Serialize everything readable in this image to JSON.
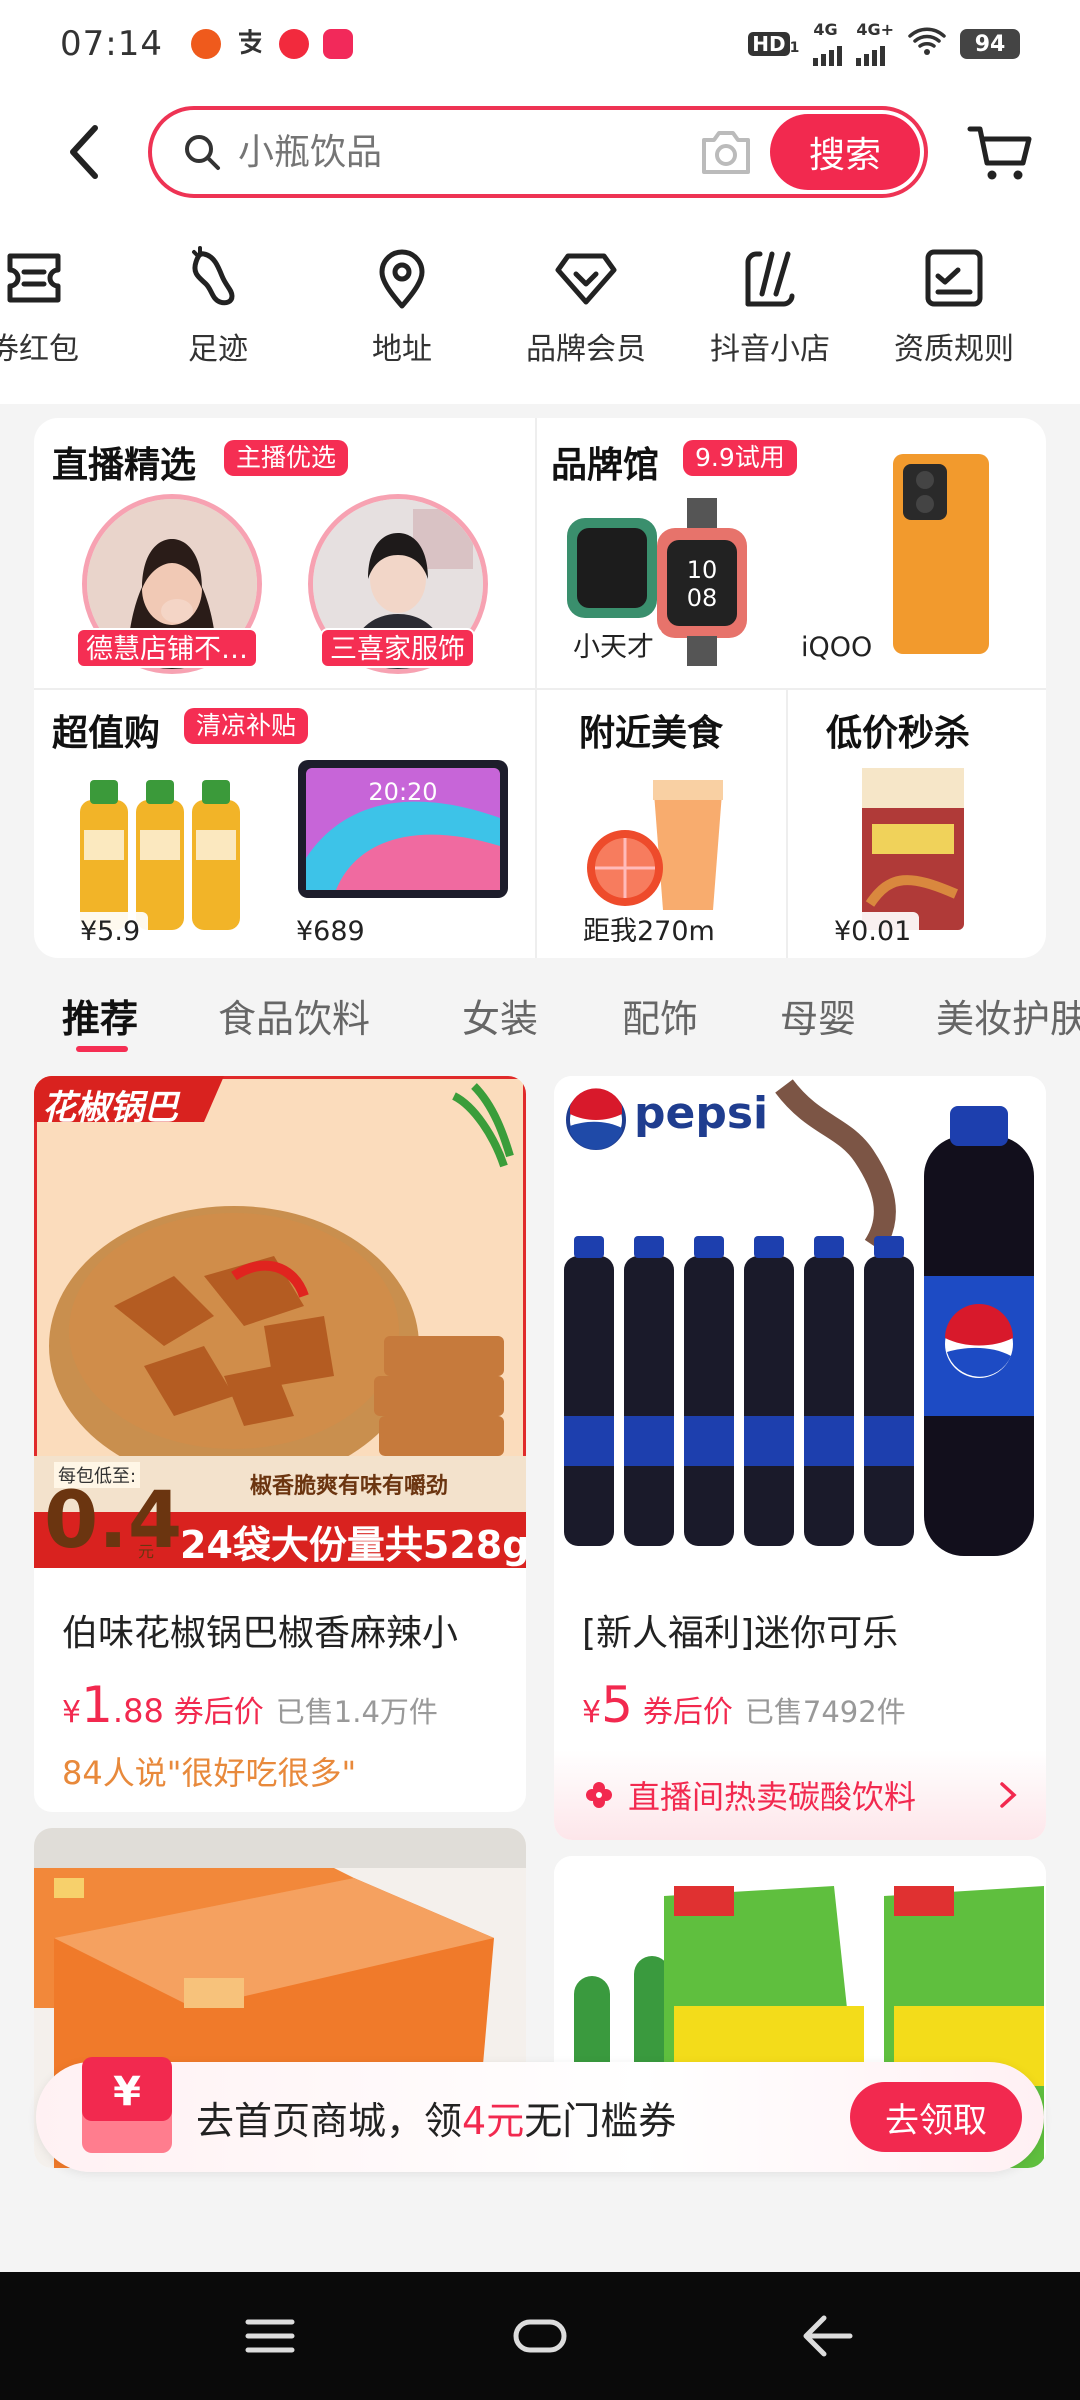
{
  "status_bar": {
    "time": "07:14",
    "hd": "HD",
    "hd_sub": "1",
    "net1": "4G",
    "net2": "4G+",
    "battery": "94"
  },
  "search": {
    "placeholder": "小瓶饮品",
    "button_label": "搜索"
  },
  "shortcuts": [
    {
      "label": "券红包",
      "icon": "coupon-icon"
    },
    {
      "label": "足迹",
      "icon": "footprint-icon"
    },
    {
      "label": "地址",
      "icon": "location-pin-icon"
    },
    {
      "label": "品牌会员",
      "icon": "diamond-icon"
    },
    {
      "label": "抖音小店",
      "icon": "shop-icon"
    },
    {
      "label": "资质规则",
      "icon": "checklist-icon"
    }
  ],
  "promo": {
    "live": {
      "title": "直播精选",
      "tag": "主播优选",
      "hosts": [
        "德慧店铺不…",
        "三喜家服饰"
      ]
    },
    "brand": {
      "title": "品牌馆",
      "tag": "9.9试用",
      "items": [
        "小天才",
        "iQOO"
      ]
    },
    "value": {
      "title": "超值购",
      "tag": "清凉补贴",
      "prices": [
        "¥5.9",
        "¥689"
      ]
    },
    "food": {
      "title": "附近美食",
      "distance": "距我270m"
    },
    "flash": {
      "title": "低价秒杀",
      "price": "¥0.01"
    }
  },
  "categories": [
    "推荐",
    "食品饮料",
    "女装",
    "配饰",
    "母婴",
    "美妆护肤"
  ],
  "products": [
    {
      "banner": "花椒锅巴",
      "per_bag_label": "每包低至:",
      "per_bag_price": "0.4",
      "per_bag_unit": "元",
      "slogan": "椒香脆爽有味有嚼劲",
      "pack": "24袋大份量共528g",
      "title": "伯味花椒锅巴椒香麻辣小",
      "price_yen": "¥",
      "price_int": "1",
      "price_dec": ".88",
      "coupon": "券后价",
      "sold": "已售1.4万件",
      "review": "84人说\"很好吃很多\""
    },
    {
      "brand": "pepsi",
      "title": "[新人福利]迷你可乐",
      "price_yen": "¥",
      "price_int": "5",
      "price_dec": "",
      "coupon": "券后价",
      "sold": "已售7492件",
      "live": "直播间热卖碳酸饮料"
    }
  ],
  "coupon_banner": {
    "text_before": "去首页商城，领",
    "text_highlight": "4元",
    "text_after": "无门槛券",
    "button": "去领取",
    "icon_symbol": "¥"
  },
  "colors": {
    "accent": "#f2294f",
    "review": "#e8893b"
  }
}
